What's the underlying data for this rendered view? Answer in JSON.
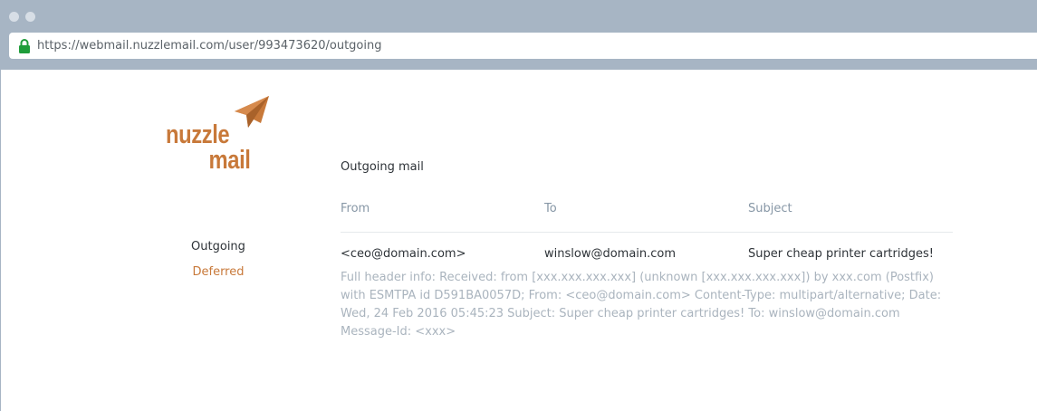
{
  "browser": {
    "url": "https://webmail.nuzzlemail.com/user/993473620/outgoing"
  },
  "logo": {
    "line1": "nuzzle",
    "line2": "mail",
    "color": "#c8793a"
  },
  "sidebar": {
    "items": [
      {
        "label": "Outgoing",
        "active": true
      },
      {
        "label": "Deferred",
        "active": false
      }
    ]
  },
  "main": {
    "title": "Outgoing mail",
    "columns": [
      "From",
      "To",
      "Subject"
    ],
    "rows": [
      {
        "from": "<ceo@domain.com>",
        "to": "winslow@domain.com",
        "subject": "Super cheap printer cartridges!",
        "details": "Full header info: Received: from [xxx.xxx.xxx.xxx] (unknown [xxx.xxx.xxx.xxx]) by xxx.com (Postfix) with ESMTPA id D591BA0057D; From: <ceo@domain.com> Content-Type: multipart/alternative; Date: Wed, 24 Feb 2016 05:45:23 Subject: Super cheap printer cartridges! To: winslow@domain.com Message-Id: <xxx>"
      }
    ]
  },
  "colors": {
    "accent": "#c8793a",
    "chrome": "#a7b5c4",
    "muted_text": "#aab4be"
  }
}
